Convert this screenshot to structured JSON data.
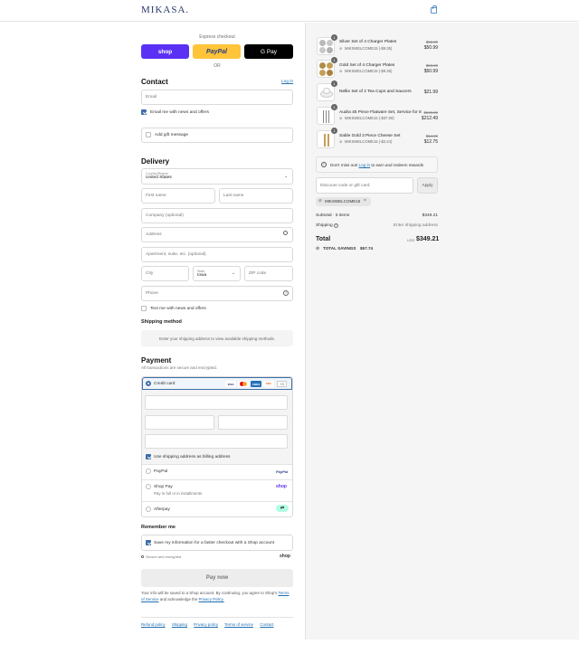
{
  "brand": {
    "name": "MIKASA."
  },
  "express": {
    "label": "Express checkout",
    "shop_label": "shop",
    "paypal_label": "PayPal",
    "gpay_label": "G Pay",
    "or_label": "OR"
  },
  "contact": {
    "title": "Contact",
    "login_link": "Log in",
    "email_placeholder": "Email",
    "email_news_label": "Email me with news and offers",
    "gift_label": "Add gift message"
  },
  "delivery": {
    "title": "Delivery",
    "country_label": "Country/Region",
    "country_value": "United States",
    "first_name": "First name",
    "last_name": "Last name",
    "company": "Company (optional)",
    "address": "Address",
    "apartment": "Apartment, suite, etc. (optional)",
    "city": "City",
    "state_label": "State",
    "state_value": "Iowa",
    "zip": "ZIP code",
    "phone": "Phone",
    "text_news_label": "Text me with news and offers"
  },
  "shipping_method": {
    "title": "Shipping method",
    "message": "Enter your shipping address to view available shipping methods."
  },
  "payment": {
    "title": "Payment",
    "subtitle": "All transactions are secure and encrypted.",
    "credit_card_label": "Credit card",
    "card_brands": [
      "VISA",
      "MC",
      "AMEX",
      "DISC"
    ],
    "more_brands": "+3",
    "billing_same_label": "Use shipping address as billing address",
    "paypal_option": "PayPal",
    "paypal_logo": "PayPal",
    "shoppay_option": "Shop Pay",
    "shoppay_sub": "Pay in full or in installments",
    "shoppay_logo": "shop",
    "afterpay_option": "Afterpay",
    "afterpay_icon": "afterpay-icon"
  },
  "remember": {
    "title": "Remember me",
    "save_label": "Save my information for a faster checkout with a Shop account",
    "secure_label": "Secure and encrypted",
    "shop_logo": "shop"
  },
  "pay_button": "Pay now",
  "consent": {
    "text_1": "Your info will be saved to a Shop account. By continuing, you agree to Shop's",
    "terms": "Terms of Service",
    "text_2": "and acknowledge the",
    "privacy": "Privacy Policy."
  },
  "footer_links": [
    "Refund policy",
    "Shipping",
    "Privacy policy",
    "Terms of service",
    "Contact"
  ],
  "order": {
    "items": [
      {
        "name": "Silver Set of 4 Charger Plates",
        "discount": "MIKSWELCOME15 (-$9.35)",
        "original": "$62.99",
        "price": "$50.99",
        "qty": "1"
      },
      {
        "name": "Gold Set of 4 Charger Plates",
        "discount": "MIKSWELCOME15 (-$9.35)",
        "original": "$59.99",
        "price": "$50.99",
        "qty": "1"
      },
      {
        "name": "Nellie Set of 2 Tea Cups and Saucers",
        "discount": "",
        "original": "",
        "price": "$21.99",
        "qty": "1"
      },
      {
        "name": "Audra 45 Piece Flatware Set, Service for 8",
        "discount": "MIKSWELCOME15 (-$37.50)",
        "original": "$249.99",
        "price": "$212.49",
        "qty": "1"
      },
      {
        "name": "Sable Gold 3 Piece Cheese Set",
        "discount": "MIKSWELCOME15 (-$2.24)",
        "original": "$14.99",
        "price": "$12.75",
        "qty": "1"
      }
    ],
    "rewards_notice_prefix": "Don't miss out!",
    "rewards_link": "Log in",
    "rewards_notice_suffix": "to earn and redeem rewards",
    "discount_placeholder": "Discount code or gift card",
    "apply_label": "Apply",
    "applied_code": "MIKSWELCOME15",
    "subtotal_label": "Subtotal · 5 items",
    "subtotal_value": "$349.21",
    "shipping_label": "Shipping",
    "shipping_value": "Enter shipping address",
    "total_label": "Total",
    "currency": "USD",
    "total_value": "$349.21",
    "savings_label": "TOTAL SAVINGS",
    "savings_value": "$57.74"
  },
  "colors": {
    "accent": "#3f6fa8",
    "shop_purple": "#5a31f4",
    "paypal_yellow": "#ffc439",
    "link": "#1f6fb2"
  }
}
